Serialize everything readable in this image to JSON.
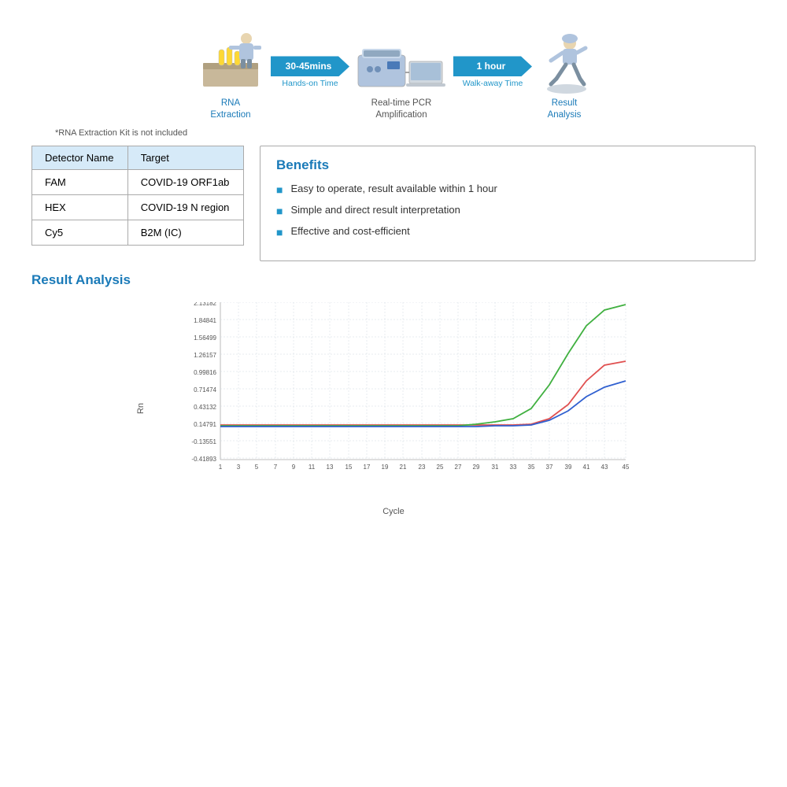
{
  "workflow": {
    "step1_label": "RNA\nExtraction",
    "arrow1_time": "30-45mins",
    "arrow1_sub": "Hands-on Time",
    "step2_label": "Real-time PCR\nAmplification",
    "arrow2_time": "1 hour",
    "arrow2_sub": "Walk-away Time",
    "step3_label": "Result\nAnalysis"
  },
  "rna_note": "*RNA Extraction Kit is not included",
  "table": {
    "col1": "Detector Name",
    "col2": "Target",
    "rows": [
      {
        "detector": "FAM",
        "target": "COVID-19 ORF1ab"
      },
      {
        "detector": "HEX",
        "target": "COVID-19 N region"
      },
      {
        "detector": "Cy5",
        "target": "B2M (IC)"
      }
    ]
  },
  "benefits": {
    "title": "Benefits",
    "items": [
      "Easy to operate, result available within 1 hour",
      "Simple and direct result interpretation",
      "Effective and cost-efficient"
    ]
  },
  "result_analysis": {
    "title": "Result Analysis",
    "y_axis_label": "Rn",
    "x_axis_label": "Cycle",
    "y_values": [
      "2.13182",
      "1.84841",
      "1.56499",
      "1.26157",
      "0.99816",
      "0.71474",
      "0.43132",
      "0.14791",
      "-0.13551",
      "-0.41893"
    ],
    "x_values": [
      "1",
      "3",
      "5",
      "7",
      "9",
      "11",
      "13",
      "15",
      "17",
      "19",
      "21",
      "23",
      "25",
      "27",
      "29",
      "31",
      "33",
      "35",
      "37",
      "39",
      "41",
      "43",
      "45"
    ]
  }
}
